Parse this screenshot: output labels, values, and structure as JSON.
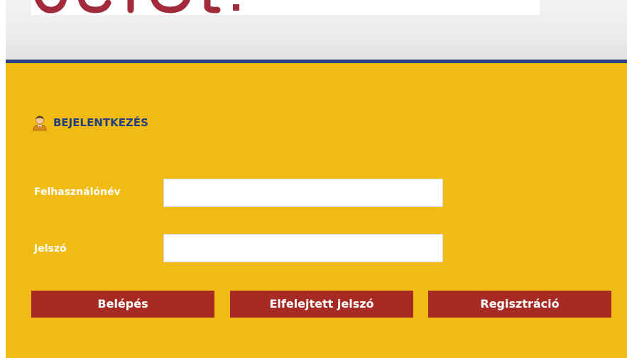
{
  "header": {
    "logo_name": "site-logo"
  },
  "login": {
    "title": "BEJELENTKEZÉS",
    "title_icon": "user-icon",
    "username_label": "Felhasználónév",
    "username_value": "",
    "password_label": "Jelszó",
    "password_value": "",
    "buttons": {
      "login": "Belépés",
      "forgot": "Elfelejtett jelszó",
      "register": "Regisztráció"
    }
  },
  "colors": {
    "panel": "#f2bb14",
    "header_line": "#2d4283",
    "button": "#a62b24",
    "title": "#203f80",
    "logo": "#a12b3a"
  }
}
